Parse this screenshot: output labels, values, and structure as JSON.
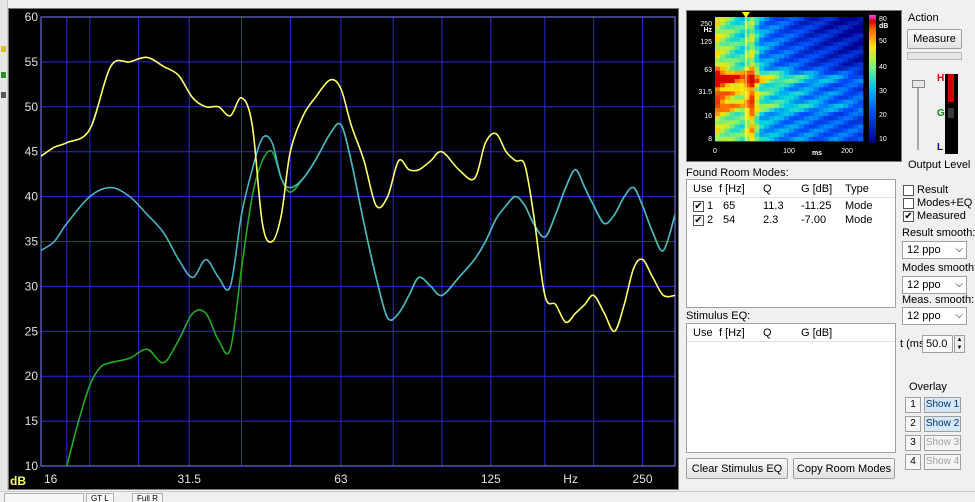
{
  "graph": {
    "y_ticks": [
      "60",
      "55",
      "50",
      "45",
      "40",
      "35",
      "30",
      "25",
      "20",
      "15",
      "10"
    ],
    "y_unit": "dB",
    "x_ticks": [
      "16",
      "31.5",
      "63",
      "125",
      "250"
    ],
    "x_unit": "Hz",
    "colors": {
      "yellow": "#ffff66",
      "cyan": "#4ab3c8",
      "green": "#22aa22",
      "grid": "#2a2ad8"
    }
  },
  "chart_data": {
    "type": "line",
    "xscale": "log",
    "xlim": [
      16,
      290
    ],
    "ylim": [
      10,
      60
    ],
    "ylabel": "dB",
    "xlabel": "Hz",
    "series": [
      {
        "color": "#ffff66",
        "x": [
          16,
          17,
          18,
          20,
          22,
          24,
          26,
          28,
          30,
          32,
          34,
          36,
          38,
          40,
          42,
          44,
          46,
          48,
          50,
          53,
          56,
          60,
          63,
          66,
          70,
          74,
          78,
          82,
          86,
          90,
          95,
          100,
          108,
          116,
          122,
          128,
          134,
          140,
          146,
          152,
          160,
          168,
          176,
          184,
          192,
          200,
          210,
          220,
          230,
          240,
          250,
          262,
          275,
          290
        ],
        "y": [
          44.5,
          45.5,
          46,
          47.5,
          54.5,
          55,
          55.5,
          54.5,
          53.5,
          51,
          50,
          50,
          49,
          51,
          48,
          37,
          35,
          38,
          45,
          49,
          51,
          53,
          52,
          48,
          44,
          39,
          40,
          44,
          43,
          43,
          44,
          45,
          43,
          42,
          46,
          47,
          45,
          44,
          43.5,
          38,
          29,
          28,
          26,
          27,
          28,
          29,
          27,
          25,
          28,
          32,
          33,
          31,
          29,
          29
        ]
      },
      {
        "color": "#4ab3c8",
        "x": [
          16,
          17,
          18,
          20,
          22,
          24,
          26,
          28,
          30,
          32,
          34,
          36,
          38,
          40,
          42,
          44,
          46,
          48,
          50,
          53,
          56,
          60,
          63,
          66,
          70,
          74,
          78,
          82,
          86,
          90,
          95,
          100,
          108,
          116,
          122,
          128,
          134,
          140,
          146,
          152,
          160,
          168,
          176,
          184,
          192,
          200,
          210,
          220,
          230,
          240,
          250,
          262,
          275,
          290
        ],
        "y": [
          34,
          35,
          37,
          40,
          41,
          40,
          38,
          36,
          33,
          31,
          33,
          31,
          30,
          38,
          43,
          46.5,
          46,
          42,
          41,
          42,
          44,
          47,
          48,
          44,
          37,
          31,
          26.5,
          27,
          29,
          31,
          30,
          29,
          31,
          33,
          35,
          37.5,
          39,
          40,
          39,
          37,
          35.5,
          38,
          41,
          43,
          41,
          39,
          37,
          38,
          40,
          41,
          39,
          36,
          34,
          38
        ]
      },
      {
        "color": "#22aa22",
        "x": [
          18,
          19,
          20,
          21,
          22,
          24,
          26,
          28,
          30,
          32,
          34,
          36,
          38,
          40,
          42,
          44,
          46,
          48,
          50,
          53,
          56,
          60,
          63,
          66,
          70,
          74,
          78,
          82,
          86,
          90,
          95,
          100,
          108,
          116,
          122,
          128,
          134,
          140,
          146,
          152,
          160,
          168,
          176,
          184,
          192,
          200,
          210,
          220,
          230,
          240,
          250,
          262,
          275,
          290
        ],
        "y": [
          10,
          15,
          19,
          21,
          21.5,
          22,
          23,
          21.5,
          24,
          27,
          27,
          24,
          23,
          32,
          40,
          44,
          45,
          42,
          40.5,
          42,
          44,
          47,
          48,
          44,
          37,
          31,
          26.5,
          27,
          29,
          31,
          30,
          29,
          31,
          33,
          35,
          37.5,
          39,
          40,
          39,
          37,
          35.5,
          38,
          41,
          43,
          41,
          39,
          37,
          38,
          40,
          41,
          39,
          36,
          34,
          38
        ]
      }
    ]
  },
  "spectrogram": {
    "y_ticks": [
      "250",
      "125",
      "63",
      "31.5",
      "16",
      "8"
    ],
    "y_unit": "Hz",
    "x_ticks": [
      "0",
      "100",
      "200"
    ],
    "x_unit": "ms",
    "scale_ticks": [
      "80",
      "50",
      "40",
      "30",
      "20",
      "10"
    ],
    "scale_unit": "dB"
  },
  "action": {
    "title": "Action",
    "measure_label": "Measure",
    "level_high": "H",
    "level_good": "G",
    "level_low": "L",
    "output_level_label": "Output Level"
  },
  "found_modes": {
    "title": "Found Room Modes:",
    "columns": [
      "Use",
      "f [Hz]",
      "Q",
      "G [dB]",
      "Type"
    ],
    "rows": [
      {
        "use": "✔",
        "index": "1",
        "f": "65",
        "q": "11.3",
        "g": "-11.25",
        "type": "Mode"
      },
      {
        "use": "✔",
        "index": "2",
        "f": "54",
        "q": "2.3",
        "g": "-7.00",
        "type": "Mode"
      }
    ]
  },
  "stimulus_eq": {
    "title": "Stimulus EQ:",
    "columns": [
      "Use",
      "f [Hz]",
      "Q",
      "G [dB]"
    ]
  },
  "buttons": {
    "clear_stimulus": "Clear Stimulus EQ",
    "copy_modes": "Copy Room Modes"
  },
  "options": {
    "result_label": "Result",
    "modes_eq_label": "Modes+EQ",
    "measured_label": "Measured",
    "measured_checked": "✔",
    "result_smooth_label": "Result smooth:",
    "result_smooth_value": "12 ppo",
    "modes_smooth_label": "Modes smooth:",
    "modes_smooth_value": "12 ppo",
    "meas_smooth_label": "Meas. smooth:",
    "meas_smooth_value": "12 ppo",
    "t_label": "t (ms)",
    "t_value": "50.0"
  },
  "overlay": {
    "title": "Overlay",
    "items": [
      {
        "num": "1",
        "label": "Show 1"
      },
      {
        "num": "2",
        "label": "Show 2"
      },
      {
        "num": "3",
        "label": "Show 3"
      },
      {
        "num": "4",
        "label": "Show 4"
      }
    ]
  },
  "bottom_tabs": [
    "",
    "GT L",
    "Full R"
  ]
}
